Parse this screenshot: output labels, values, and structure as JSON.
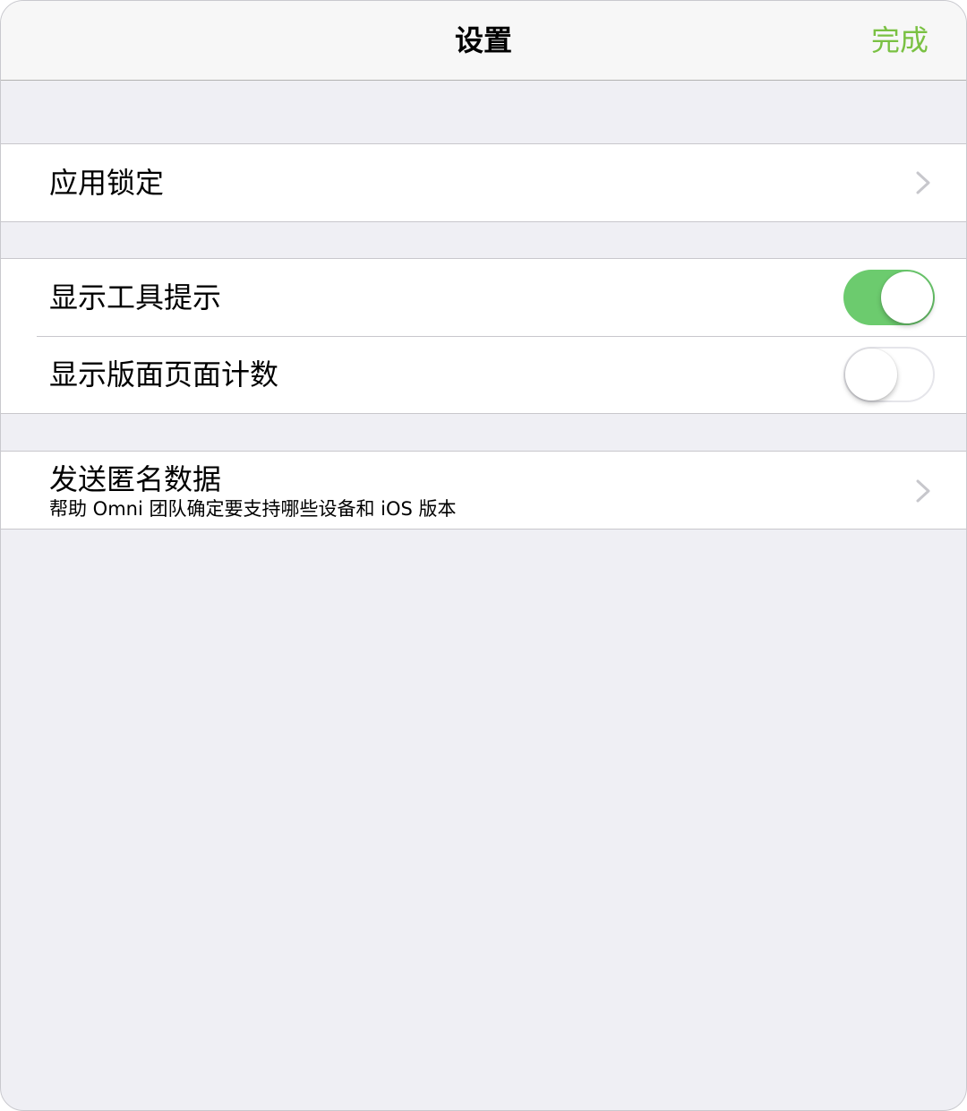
{
  "navbar": {
    "title": "设置",
    "done_label": "完成",
    "accent_color": "#7ac143"
  },
  "sections": {
    "app_lock": {
      "label": "应用锁定",
      "chevron_icon": "chevron-right-icon"
    },
    "display": {
      "show_tooltips": {
        "label": "显示工具提示",
        "enabled": true
      },
      "show_page_count": {
        "label": "显示版面页面计数",
        "enabled": false
      }
    },
    "analytics": {
      "title": "发送匿名数据",
      "subtitle": "帮助 Omni 团队确定要支持哪些设备和 iOS 版本",
      "chevron_icon": "chevron-right-icon"
    }
  },
  "colors": {
    "toggle_on": "#6ccb6e",
    "background": "#efeff4",
    "separator": "#c8c7cc"
  }
}
